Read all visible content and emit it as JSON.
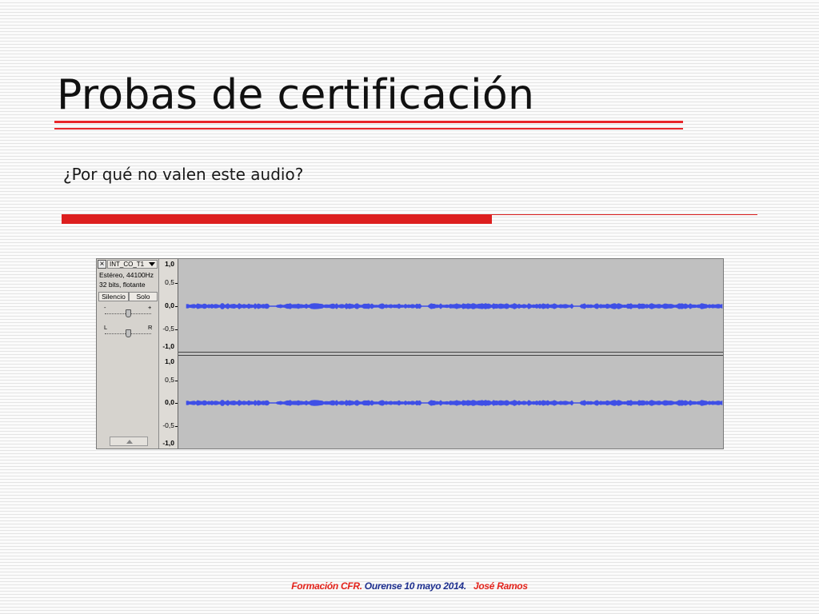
{
  "slide": {
    "title": "Probas de certificación",
    "subtitle": "¿Por qué no valen este audio?",
    "footer": {
      "part1": "Formación CFR.",
      "part2": " Ourense 10 mayo 2014.",
      "part3": "José Ramos"
    }
  },
  "colors": {
    "accent_red": "#e8262a",
    "footer_red": "#e3231b",
    "footer_blue": "#1d2f8f",
    "waveform": "#3f4fe6",
    "wave_bg": "#c0c0c0"
  },
  "audacity": {
    "close_glyph": "×",
    "track_name": "INT_CO_T1",
    "info_line1": "Estéreo, 44100Hz",
    "info_line2": "32 bits, flotante",
    "mute_label": "Silencio",
    "solo_label": "Solo",
    "gain_minus": "-",
    "gain_plus": "+",
    "pan_left": "L",
    "pan_right": "R",
    "icons": {
      "close": "close-icon",
      "dropdown": "chevron-down-icon",
      "collapse": "collapse-up-icon"
    },
    "channel_ruler_labels": [
      "1,0",
      "0,5",
      "0,0",
      "-0,5",
      "-1,0"
    ]
  }
}
